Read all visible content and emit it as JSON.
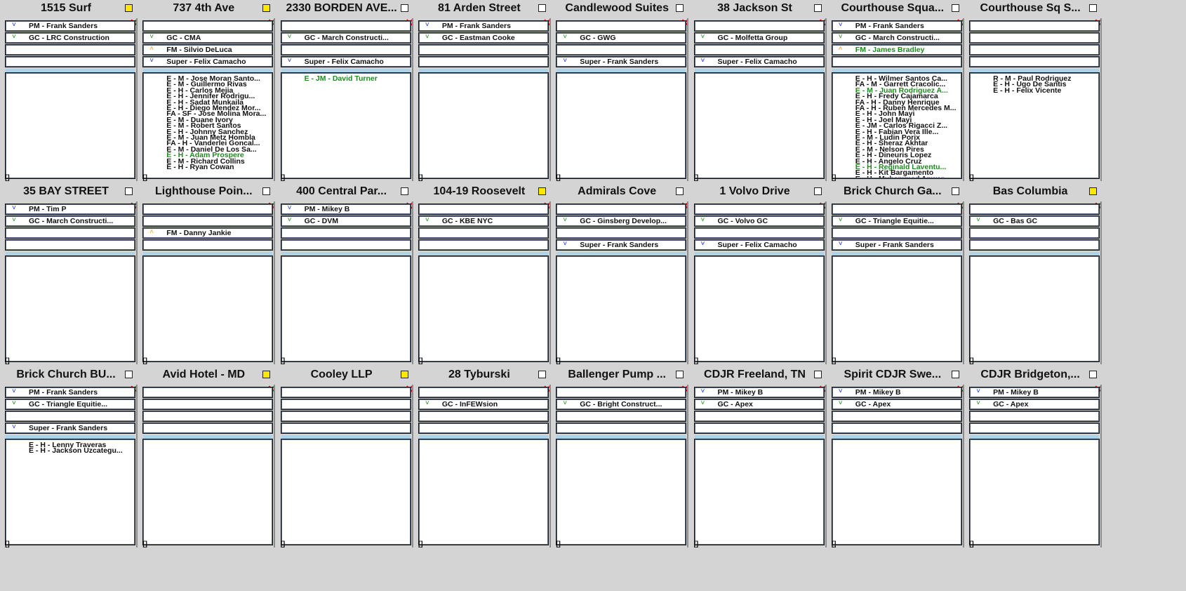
{
  "colors": {
    "checked": "#ffe800",
    "close": "#e01010",
    "green_text": "#1e8a1e",
    "band": "#a9d4ec",
    "dot_blue": "#1030d0",
    "dot_green": "#1a8a1a",
    "dot_orange": "#f0a020"
  },
  "close_glyph": "✕",
  "bracket_glyph": "[]",
  "cards": [
    {
      "title": "1515 Surf",
      "checked": true,
      "slots": [
        {
          "text": "PM - Frank Sanders",
          "dot": "blue"
        },
        {
          "text": "GC - LRC Construction",
          "dot": "green"
        },
        {
          "text": "",
          "dot": ""
        },
        {
          "text": "",
          "dot": ""
        }
      ],
      "crew": []
    },
    {
      "title": "737 4th Ave",
      "checked": true,
      "slots": [
        {
          "text": "",
          "dot": ""
        },
        {
          "text": "GC - CMA",
          "dot": "green"
        },
        {
          "text": "FM - Silvio DeLuca",
          "dot": "orange"
        },
        {
          "text": "Super - Felix Camacho",
          "dot": "blue"
        }
      ],
      "crew": [
        {
          "text": "E - M - Jose Moran Santo...",
          "green": false
        },
        {
          "text": "E - M - Guillermo Rivas",
          "green": false
        },
        {
          "text": "E - H - Carlos Mejia",
          "green": false
        },
        {
          "text": "E - H - Jennifer Rodrigu...",
          "green": false
        },
        {
          "text": "E - H - Sadat Munkaila",
          "green": false
        },
        {
          "text": "E - H - Diego Mendez Mor...",
          "green": false
        },
        {
          "text": "FA - SF - Jose Molina Mora...",
          "green": false
        },
        {
          "text": "E - M - Duane Ivory",
          "green": false
        },
        {
          "text": "E - M - Robert Santos",
          "green": false
        },
        {
          "text": "E - H - Johnny Sanchez",
          "green": false
        },
        {
          "text": "E - M - Juan Metz Hombla",
          "green": false
        },
        {
          "text": "FA - H - Vanderlei Goncal...",
          "green": false
        },
        {
          "text": "E - M - Daniel De Los Sa...",
          "green": false
        },
        {
          "text": "E - H - Adam Prospere",
          "green": true
        },
        {
          "text": "E - M - Richard Collins",
          "green": false
        },
        {
          "text": "E - H - Ryan Cowan",
          "green": false
        }
      ]
    },
    {
      "title": "2330 BORDEN AVE...",
      "checked": false,
      "slots": [
        {
          "text": "",
          "dot": ""
        },
        {
          "text": "GC - March Constructi...",
          "dot": "green"
        },
        {
          "text": "",
          "dot": ""
        },
        {
          "text": "Super - Felix Camacho",
          "dot": "blue"
        }
      ],
      "crew": [
        {
          "text": "E - JM - David Turner",
          "green": true
        }
      ]
    },
    {
      "title": "81 Arden Street",
      "checked": false,
      "slots": [
        {
          "text": "PM - Frank Sanders",
          "dot": "blue"
        },
        {
          "text": "GC - Eastman Cooke",
          "dot": "green"
        },
        {
          "text": "",
          "dot": ""
        },
        {
          "text": "",
          "dot": ""
        }
      ],
      "crew": []
    },
    {
      "title": "Candlewood Suites",
      "checked": false,
      "slots": [
        {
          "text": "",
          "dot": ""
        },
        {
          "text": "GC - GWG",
          "dot": "green"
        },
        {
          "text": "",
          "dot": ""
        },
        {
          "text": "Super - Frank Sanders",
          "dot": "blue"
        }
      ],
      "crew": []
    },
    {
      "title": "38 Jackson St",
      "checked": false,
      "slots": [
        {
          "text": "",
          "dot": ""
        },
        {
          "text": "GC - Molfetta Group",
          "dot": "green"
        },
        {
          "text": "",
          "dot": ""
        },
        {
          "text": "Super - Felix Camacho",
          "dot": "blue"
        }
      ],
      "crew": []
    },
    {
      "title": "Courthouse Squa...",
      "checked": false,
      "slots": [
        {
          "text": "PM - Frank Sanders",
          "dot": "blue"
        },
        {
          "text": "GC - March Constructi...",
          "dot": "green"
        },
        {
          "text": "FM - James Bradley",
          "dot": "orange",
          "green": true
        },
        {
          "text": "",
          "dot": ""
        }
      ],
      "crew": [
        {
          "text": "E - H - Wilmer Santos Ca...",
          "green": false
        },
        {
          "text": "FA - M - Garrett Cracolic...",
          "green": false
        },
        {
          "text": "E - M - Juan Rodriguez A...",
          "green": true
        },
        {
          "text": "E - H - Fredy Cajamarca",
          "green": false
        },
        {
          "text": "FA - H - Danny Henrique",
          "green": false
        },
        {
          "text": "FA - H - Ruben Mercedes M...",
          "green": false
        },
        {
          "text": "E - H - John Mayi",
          "green": false
        },
        {
          "text": "E - H - Joel Mayi",
          "green": false
        },
        {
          "text": "E - JM - Carlos Rigacci Z...",
          "green": false
        },
        {
          "text": "E - H - Fabian Vera Ille...",
          "green": false
        },
        {
          "text": "E - M - Ludin Porix",
          "green": false
        },
        {
          "text": "E - H - Sheraz Akhtar",
          "green": false
        },
        {
          "text": "E - M - Nelson Pires",
          "green": false
        },
        {
          "text": "E - H - Dineuris Lopez",
          "green": false
        },
        {
          "text": "E - H - Angelo Cruz",
          "green": false
        },
        {
          "text": "E - H - Reginald Laventu...",
          "green": true
        },
        {
          "text": "E - H - Kit Bargamento",
          "green": false
        },
        {
          "text": "E - H - Muhammad Anwar",
          "green": false
        }
      ]
    },
    {
      "title": "Courthouse Sq S...",
      "checked": false,
      "slots": [
        {
          "text": "",
          "dot": ""
        },
        {
          "text": "",
          "dot": ""
        },
        {
          "text": "",
          "dot": ""
        },
        {
          "text": "",
          "dot": ""
        }
      ],
      "crew": [
        {
          "text": "R - M - Paul Rodriguez",
          "green": false
        },
        {
          "text": "E - H - Ugo De Santis",
          "green": false
        },
        {
          "text": "E - H - Felix Vicente",
          "green": false
        }
      ]
    },
    {
      "title": "35 BAY STREET",
      "checked": false,
      "slots": [
        {
          "text": "PM - Tim P",
          "dot": "blue"
        },
        {
          "text": "GC - March Constructi...",
          "dot": "green"
        },
        {
          "text": "",
          "dot": ""
        },
        {
          "text": "",
          "dot": ""
        }
      ],
      "crew": []
    },
    {
      "title": "Lighthouse Poin...",
      "checked": false,
      "slots": [
        {
          "text": "",
          "dot": ""
        },
        {
          "text": "",
          "dot": ""
        },
        {
          "text": "FM - Danny Jankie",
          "dot": "orange"
        },
        {
          "text": "",
          "dot": ""
        }
      ],
      "crew": []
    },
    {
      "title": "400 Central Par...",
      "checked": false,
      "slots": [
        {
          "text": "PM - Mikey B",
          "dot": "blue"
        },
        {
          "text": "GC - DVM",
          "dot": "green"
        },
        {
          "text": "",
          "dot": ""
        },
        {
          "text": "",
          "dot": ""
        }
      ],
      "crew": []
    },
    {
      "title": "104-19 Roosevelt",
      "checked": true,
      "slots": [
        {
          "text": "",
          "dot": ""
        },
        {
          "text": "GC - KBE NYC",
          "dot": "green"
        },
        {
          "text": "",
          "dot": ""
        },
        {
          "text": "",
          "dot": ""
        }
      ],
      "crew": []
    },
    {
      "title": "Admirals Cove",
      "checked": false,
      "slots": [
        {
          "text": "",
          "dot": ""
        },
        {
          "text": "GC - Ginsberg Develop...",
          "dot": "green"
        },
        {
          "text": "",
          "dot": ""
        },
        {
          "text": "Super - Frank Sanders",
          "dot": "blue"
        }
      ],
      "crew": []
    },
    {
      "title": "1 Volvo Drive",
      "checked": false,
      "slots": [
        {
          "text": "",
          "dot": ""
        },
        {
          "text": "GC - Volvo GC",
          "dot": "green"
        },
        {
          "text": "",
          "dot": ""
        },
        {
          "text": "Super - Felix Camacho",
          "dot": "blue"
        }
      ],
      "crew": []
    },
    {
      "title": "Brick Church Ga...",
      "checked": false,
      "slots": [
        {
          "text": "",
          "dot": ""
        },
        {
          "text": "GC - Triangle Equitie...",
          "dot": "green"
        },
        {
          "text": "",
          "dot": ""
        },
        {
          "text": "Super - Frank Sanders",
          "dot": "blue"
        }
      ],
      "crew": []
    },
    {
      "title": "Bas Columbia",
      "checked": true,
      "slots": [
        {
          "text": "",
          "dot": ""
        },
        {
          "text": "GC - Bas GC",
          "dot": "green"
        },
        {
          "text": "",
          "dot": ""
        },
        {
          "text": "",
          "dot": ""
        }
      ],
      "crew": []
    },
    {
      "title": "Brick Church BU...",
      "checked": false,
      "slots": [
        {
          "text": "PM - Frank Sanders",
          "dot": "blue"
        },
        {
          "text": "GC - Triangle Equitie...",
          "dot": "green"
        },
        {
          "text": "",
          "dot": ""
        },
        {
          "text": "Super - Frank Sanders",
          "dot": "blue"
        }
      ],
      "crew": [
        {
          "text": "E - H - Lenny Traveras",
          "green": false
        },
        {
          "text": "E - H - Jackson Uzcategu...",
          "green": false
        }
      ]
    },
    {
      "title": "Avid Hotel - MD",
      "checked": true,
      "slots": [
        {
          "text": "",
          "dot": ""
        },
        {
          "text": "",
          "dot": ""
        },
        {
          "text": "",
          "dot": ""
        },
        {
          "text": "",
          "dot": ""
        }
      ],
      "crew": []
    },
    {
      "title": "Cooley LLP",
      "checked": true,
      "slots": [
        {
          "text": "",
          "dot": ""
        },
        {
          "text": "",
          "dot": ""
        },
        {
          "text": "",
          "dot": ""
        },
        {
          "text": "",
          "dot": ""
        }
      ],
      "crew": []
    },
    {
      "title": "28 Tyburski",
      "checked": false,
      "slots": [
        {
          "text": "",
          "dot": ""
        },
        {
          "text": "GC - InFEWsion",
          "dot": "green"
        },
        {
          "text": "",
          "dot": ""
        },
        {
          "text": "",
          "dot": ""
        }
      ],
      "crew": []
    },
    {
      "title": "Ballenger Pump ...",
      "checked": false,
      "slots": [
        {
          "text": "",
          "dot": ""
        },
        {
          "text": "GC - Bright Construct...",
          "dot": "green"
        },
        {
          "text": "",
          "dot": ""
        },
        {
          "text": "",
          "dot": ""
        }
      ],
      "crew": []
    },
    {
      "title": "CDJR Freeland, TN",
      "checked": false,
      "slots": [
        {
          "text": "PM - Mikey B",
          "dot": "blue"
        },
        {
          "text": "GC - Apex",
          "dot": "green"
        },
        {
          "text": "",
          "dot": ""
        },
        {
          "text": "",
          "dot": ""
        }
      ],
      "crew": []
    },
    {
      "title": "Spirit CDJR Swe...",
      "checked": false,
      "slots": [
        {
          "text": "PM - Mikey B",
          "dot": "blue"
        },
        {
          "text": "GC - Apex",
          "dot": "green"
        },
        {
          "text": "",
          "dot": ""
        },
        {
          "text": "",
          "dot": ""
        }
      ],
      "crew": []
    },
    {
      "title": "CDJR Bridgeton,...",
      "checked": false,
      "slots": [
        {
          "text": "PM - Mikey B",
          "dot": "blue"
        },
        {
          "text": "GC - Apex",
          "dot": "green"
        },
        {
          "text": "",
          "dot": ""
        },
        {
          "text": "",
          "dot": ""
        }
      ],
      "crew": []
    }
  ]
}
